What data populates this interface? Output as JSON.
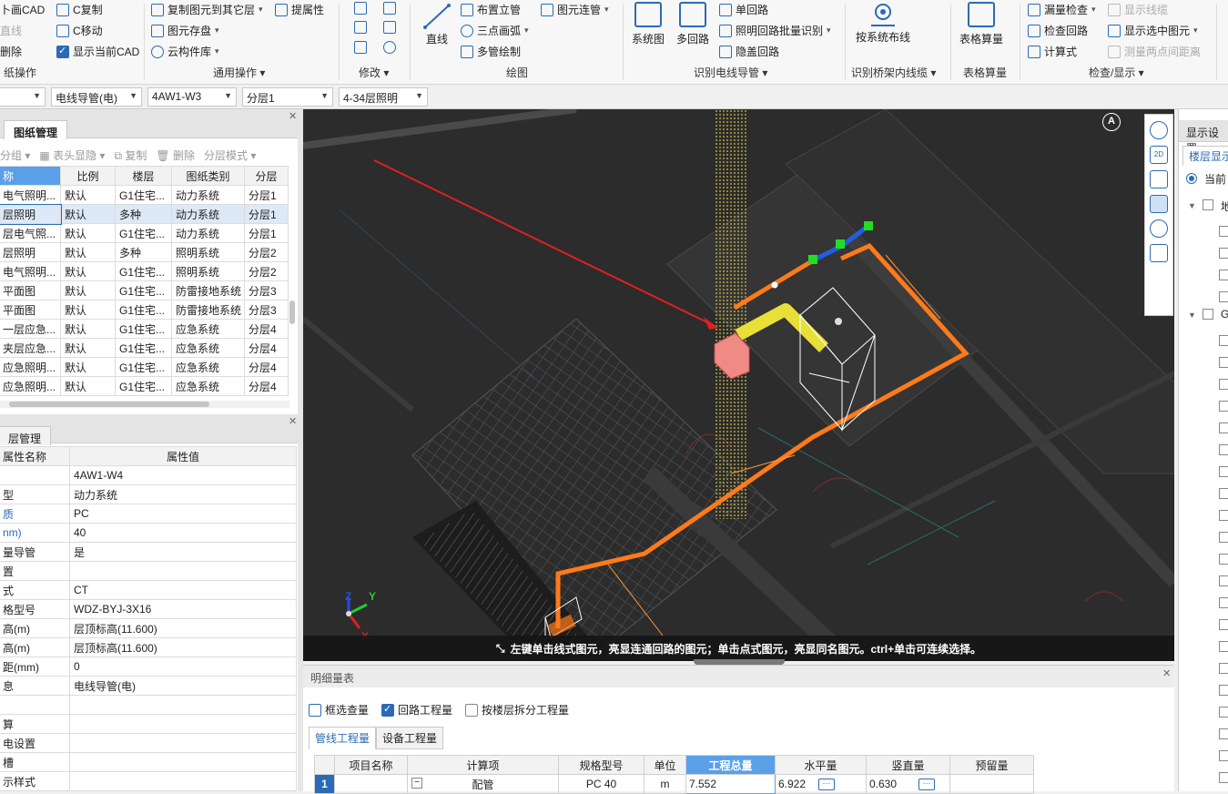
{
  "ribbon": {
    "groups": [
      {
        "label": "纸操作"
      },
      {
        "label": "通用操作"
      },
      {
        "label": "修改"
      },
      {
        "label": "绘图"
      },
      {
        "label": "识别电线导管"
      },
      {
        "label": "识别桥架内线缆"
      },
      {
        "label": "表格算量"
      },
      {
        "label": "检查/显示"
      }
    ],
    "drawing_ops": {
      "row1": "卜画CAD",
      "row2": "直线",
      "row3": "删除"
    },
    "common_ops": {
      "copy": "C复制",
      "move": "C移动",
      "show_cad": "显示当前CAD",
      "copy_to_floor": "复制图元到其它层",
      "save_elem": "图元存盘",
      "cloud_lib": "云构件库",
      "extract_attr": "提属性"
    },
    "draw": {
      "line": "直线",
      "riser": "布置立管",
      "arc": "三点画弧",
      "multi_pipe": "多管绘制",
      "elem_connect": "图元连管"
    },
    "recognize": {
      "system_diagram": "系统图",
      "multi_loop": "多回路",
      "single_loop": "单回路",
      "lighting_batch": "照明回路批量识别",
      "hidden_loop": "隐盖回路"
    },
    "tray": {
      "by_system": "按系统布线"
    },
    "table_calc": {
      "label": "表格算量"
    },
    "check": {
      "missing_check": "漏量检查",
      "show_wires": "显示线缆",
      "check_loop": "检查回路",
      "show_selected": "显示选中图元",
      "formula": "计算式",
      "measure": "测量两点间距离"
    }
  },
  "dropdowns": [
    {
      "value": ""
    },
    {
      "value": "电线导管(电)"
    },
    {
      "value": "4AW1-W3"
    },
    {
      "value": "分层1"
    },
    {
      "value": "4-34层照明"
    }
  ],
  "drawing_mgmt": {
    "title": "图纸管理",
    "toolbar": {
      "group": "分组",
      "header_toggle": "表头显隐",
      "copy": "复制",
      "delete": "删除",
      "layer_mode": "分层模式"
    },
    "columns": [
      "称",
      "比例",
      "楼层",
      "图纸类别",
      "分层"
    ],
    "rows": [
      [
        "电气照明...",
        "默认",
        "G1住宅...",
        "动力系统",
        "分层1"
      ],
      [
        "层照明",
        "默认",
        "多种",
        "动力系统",
        "分层1"
      ],
      [
        "层电气照...",
        "默认",
        "G1住宅...",
        "动力系统",
        "分层1"
      ],
      [
        "层照明",
        "默认",
        "多种",
        "照明系统",
        "分层2"
      ],
      [
        "电气照明...",
        "默认",
        "G1住宅...",
        "照明系统",
        "分层2"
      ],
      [
        "平面图",
        "默认",
        "G1住宅...",
        "防雷接地系统",
        "分层3"
      ],
      [
        "平面图",
        "默认",
        "G1住宅...",
        "防雷接地系统",
        "分层3"
      ],
      [
        "一层应急...",
        "默认",
        "G1住宅...",
        "应急系统",
        "分层4"
      ],
      [
        "夹层应急...",
        "默认",
        "G1住宅...",
        "应急系统",
        "分层4"
      ],
      [
        "应急照明...",
        "默认",
        "G1住宅...",
        "应急系统",
        "分层4"
      ],
      [
        "应急照明...",
        "默认",
        "G1住宅...",
        "应急系统",
        "分层4"
      ]
    ]
  },
  "layer_mgmt": {
    "title": "层管理",
    "columns": [
      "属性名称",
      "属性值"
    ],
    "rows": [
      [
        "",
        "4AW1-W4"
      ],
      [
        "型",
        "动力系统"
      ],
      [
        "质",
        "PC"
      ],
      [
        "nm)",
        "40"
      ],
      [
        "量导管",
        "是"
      ],
      [
        "置",
        ""
      ],
      [
        "式",
        "CT"
      ],
      [
        "格型号",
        "WDZ-BYJ-3X16"
      ],
      [
        "高(m)",
        "层顶标高(11.600)"
      ],
      [
        "高(m)",
        "层顶标高(11.600)"
      ],
      [
        "距(mm)",
        "0"
      ],
      [
        "息",
        "电线导管(电)"
      ],
      [
        "",
        ""
      ],
      [
        "算",
        ""
      ],
      [
        "电设置",
        ""
      ],
      [
        "槽",
        ""
      ],
      [
        "示样式",
        ""
      ]
    ]
  },
  "viewport": {
    "compass": "A",
    "axes": {
      "y": "Y",
      "z": "Z",
      "x": "X"
    },
    "status": "左键单击线式图元，亮显连通回路的图元；单击点式图元，亮显同名图元。ctrl+单击可连续选择。"
  },
  "view_tools": [
    "2D"
  ],
  "right_panel": {
    "title": "显示设置",
    "tab": "楼层显示",
    "radio": "当前",
    "tree_a": "地",
    "tree_b": "G"
  },
  "detail": {
    "title": "明细量表",
    "frame_select": "框选查量",
    "loop_qty": "回路工程量",
    "split_by_floor": "按楼层拆分工程量",
    "tabs": [
      "管线工程量",
      "设备工程量"
    ],
    "columns": [
      "项目名称",
      "计算项",
      "规格型号",
      "单位",
      "工程总量",
      "水平量",
      "竖直量",
      "预留量"
    ],
    "rows": [
      {
        "index": "1",
        "name": "",
        "item": "配管",
        "spec": "PC 40",
        "unit": "m",
        "total": "7.552",
        "horizontal": "6.922",
        "vertical": "0.630",
        "reserve": ""
      }
    ]
  },
  "colors": {
    "accent": "#2b6bb5",
    "pipe_orange": "#ff7a1a",
    "viewport_bg": "#2c2c2c",
    "selected_header": "#5aa0e8"
  }
}
